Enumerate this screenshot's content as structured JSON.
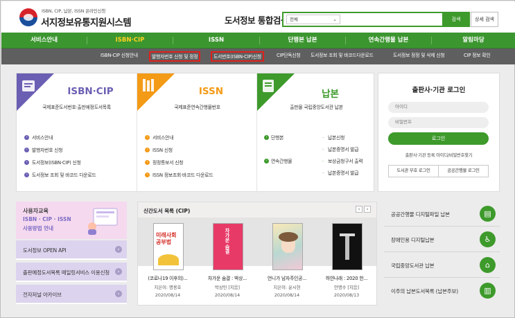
{
  "header": {
    "logo_small": "ISBN, CIP, 납본, ISSN 온라인신청",
    "logo_title": "서지정보유통지원시스템",
    "search_title": "도서정보 통합검색",
    "search_select": "전체",
    "search_placeholder": "",
    "search_button": "검색",
    "detail_button": "상세 검색"
  },
  "main_nav": [
    "서비스안내",
    "ISBN·CIP",
    "ISSN",
    "단행본 납본",
    "연속간행물 납본",
    "알림마당"
  ],
  "sub_nav": [
    "ISBN-CIP 신청안내",
    "발행자번호 신청 및 정정",
    "도서번호(ISBN-CIP)신청",
    "CIP단독신청",
    "도서정보 조회 및 바코드다운로드",
    "도서정보 정정 및 삭제 신청",
    "CIP 정보 확인"
  ],
  "cards": {
    "isbn": {
      "title": "ISBN·CIP",
      "subtitle": "국제표준도서번호·출판예정도서목록",
      "items": [
        "서비스안내",
        "발행자번호 신청",
        "도서정보(ISBN·CIP) 신청",
        "도서정보 조회 및 바코드 다운로드"
      ]
    },
    "issn": {
      "title": "ISSN",
      "subtitle": "국제표준연속간행물번호",
      "items": [
        "서비스안내",
        "ISSN 신청",
        "정정통보서 신청",
        "ISSN 정보조회·바코드 다운로드"
      ]
    },
    "napbon": {
      "title": "납본",
      "subtitle": "출판물 국립중앙도서관 납본",
      "cat1": "단행본",
      "cat2": "연속간행물",
      "items": [
        "납본신청",
        "납본증명서 발급",
        "보상금청구서 출력",
        "납본증명서 발급"
      ]
    }
  },
  "login": {
    "title": "출판사·기관 로그인",
    "id_placeholder": "아이디",
    "pw_placeholder": "비밀번호",
    "login_button": "로그인",
    "links": "출판사·기관 등록    아이디/비밀번호찾기",
    "library_login": "도서관 부호 로그인",
    "serial_login": "공공간행물 로그인"
  },
  "banner": {
    "line1": "사용자교육",
    "line2": "ISBN · CIP · ISSN",
    "line3": "사용방법 안내"
  },
  "left_menu": [
    "도서정보 OPEN API",
    "출판예정도서목록 메일링서비스 이용신청",
    "전자저널 아카이브"
  ],
  "new_books": {
    "title": "신간도서 목록 (CIP)",
    "prev": "‹",
    "next": "›",
    "items": [
      {
        "name": "(코로나19 이후의)...",
        "author": "지은이: 명용호",
        "date": "2020/08/14",
        "cover_text": "미래사회 공부법"
      },
      {
        "name": "차가운 숨결 : 박상...",
        "author": "박상민 [지음]",
        "date": "2020/08/14",
        "cover_text": "차가운 숨결"
      },
      {
        "name": "언니가 남자주인공...",
        "author": "지은이: 윤시현",
        "date": "2020/08/14",
        "cover_text": ""
      },
      {
        "name": "하얀나래 : 2020 한...",
        "author": "안명수 [지음]",
        "date": "2020/08/13",
        "cover_text": ""
      }
    ]
  },
  "right_list": [
    {
      "label": "공공간행물 디지털파일 납본",
      "icon": "document-icon"
    },
    {
      "label": "장애인용 디지털납본",
      "icon": "accessibility-icon"
    },
    {
      "label": "국립중앙도서관 납본",
      "icon": "library-icon"
    },
    {
      "label": "이주의 납본도서목록 (납본주보)",
      "icon": "books-icon"
    }
  ],
  "colors": {
    "brand_green": "#3c9630",
    "isbn_purple": "#6a5fb3",
    "issn_orange": "#f39a16",
    "napbon_green": "#3d9a2b",
    "highlight_red": "#e0201c"
  }
}
